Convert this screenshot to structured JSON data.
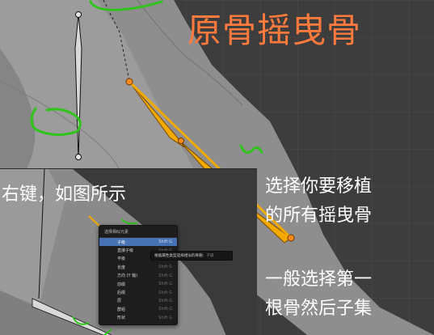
{
  "title": "原骨摇曳骨",
  "notes": {
    "right_click": "右键，如图所示",
    "select_all_lines": [
      "选择你要移植",
      "的所有摇曳骨"
    ],
    "first_bone_lines": [
      "一般选择第一",
      "根骨然后子集"
    ]
  },
  "context_menu": {
    "title": "选择相似元素",
    "items": [
      {
        "label": "子级",
        "shortcut": "Shift G",
        "active": true
      },
      {
        "label": "直接子级",
        "shortcut": "Shift G"
      },
      {
        "label": "平级",
        "shortcut": "Shift G"
      },
      {
        "label": "长度",
        "shortcut": "Shift G"
      },
      {
        "label": "方向 (Y 轴)",
        "shortcut": "Shift G"
      },
      {
        "label": "前缀",
        "shortcut": "Shift G"
      },
      {
        "label": "后缀",
        "shortcut": "Shift G"
      },
      {
        "label": "层",
        "shortcut": "Shift G"
      },
      {
        "label": "群组",
        "shortcut": "Shift G"
      },
      {
        "label": "形状",
        "shortcut": "Shift G"
      }
    ]
  },
  "tooltip": {
    "text": "根据属性类型选择相似的骨骼:",
    "hint": "子级"
  },
  "colors": {
    "title": "#ff7a3c",
    "bone_orange": "#f2a900",
    "bone_joint": "#ff8a1e",
    "annotation_green": "#2ec41a",
    "menu_highlight": "#4772b3"
  }
}
